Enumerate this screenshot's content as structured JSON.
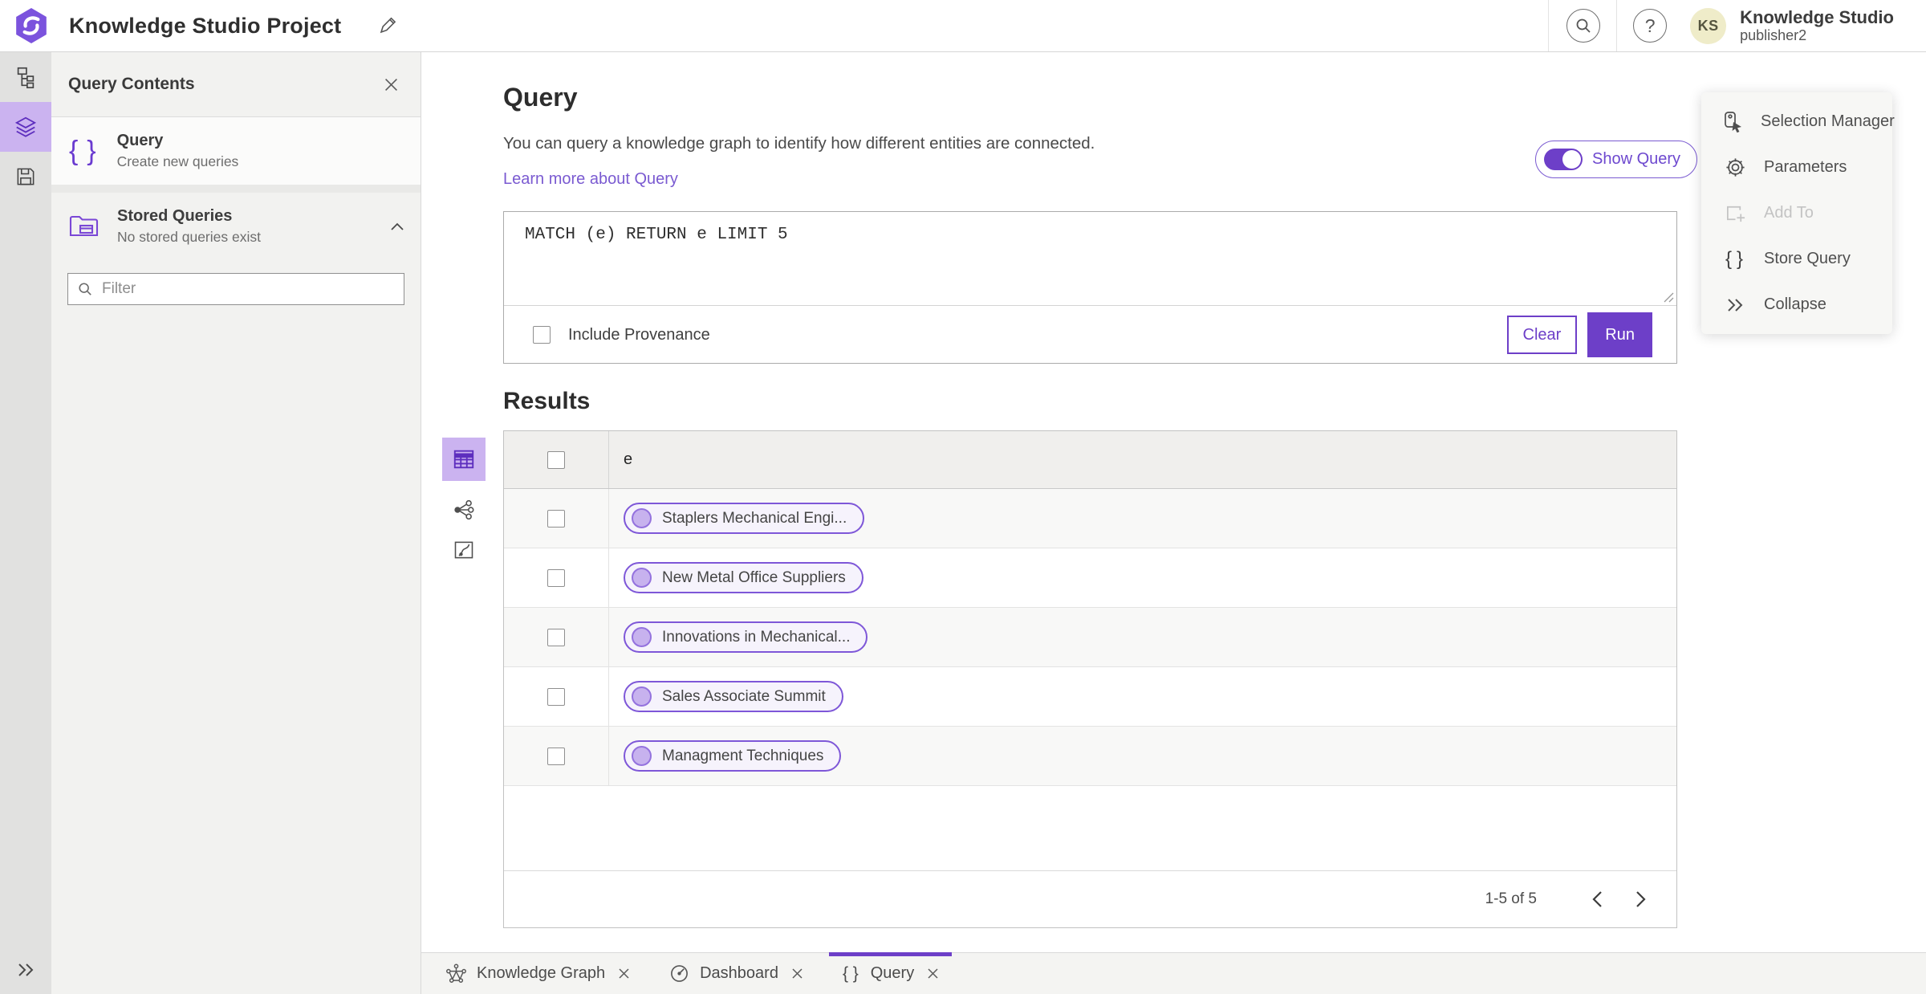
{
  "header": {
    "app_title": "Knowledge Studio Project",
    "user_name": "Knowledge Studio",
    "user_role": "publisher2",
    "avatar_initials": "KS"
  },
  "contents_panel": {
    "title": "Query Contents",
    "items": [
      {
        "label": "Query",
        "sublabel": "Create new queries"
      },
      {
        "label": "Stored Queries",
        "sublabel": "No stored queries exist"
      }
    ],
    "filter_placeholder": "Filter"
  },
  "query_section": {
    "title": "Query",
    "description": "You can query a knowledge graph to identify how different entities are connected.",
    "learn_more_label": "Learn more about Query",
    "show_query_label": "Show Query",
    "show_query_on": true,
    "query_text": "MATCH (e) RETURN e LIMIT 5",
    "include_provenance_label": "Include Provenance",
    "include_provenance_checked": false,
    "clear_label": "Clear",
    "run_label": "Run"
  },
  "results": {
    "title": "Results",
    "column_header": "e",
    "rows": [
      "Staplers Mechanical Engi...",
      "New Metal Office Suppliers",
      "Innovations in Mechanical...",
      "Sales Associate Summit",
      "Managment Techniques"
    ],
    "pagination": {
      "range_label": "1-5 of 5"
    }
  },
  "actions_menu": {
    "items": [
      {
        "label": "Selection Manager",
        "disabled": false
      },
      {
        "label": "Parameters",
        "disabled": false
      },
      {
        "label": "Add To",
        "disabled": true
      },
      {
        "label": "Store Query",
        "disabled": false
      },
      {
        "label": "Collapse",
        "disabled": false
      }
    ]
  },
  "tabs": [
    {
      "label": "Knowledge Graph",
      "active": false
    },
    {
      "label": "Dashboard",
      "active": false
    },
    {
      "label": "Query",
      "active": true
    }
  ],
  "colors": {
    "accent": "#6d3fc8",
    "accent_selection": "#cbb3f0",
    "link": "#7a5ad1",
    "pill_border": "#7e57d8",
    "pill_bg": "#f6f3fc",
    "pill_dot": "#c7b2ee",
    "avatar_bg": "#efecc9"
  }
}
